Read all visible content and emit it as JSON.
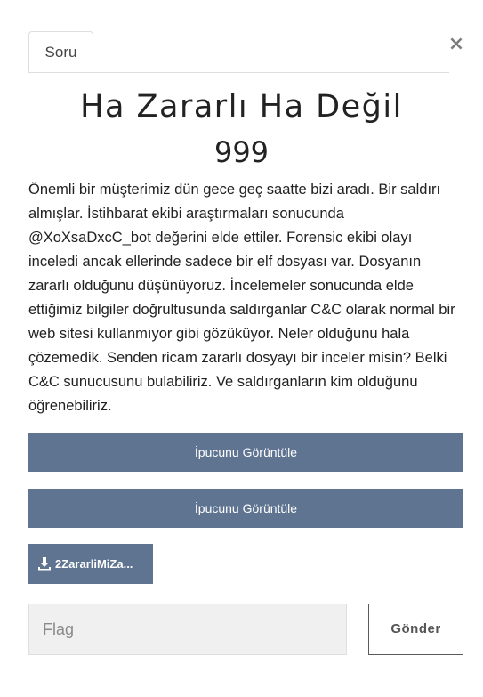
{
  "modal": {
    "close_icon": "close-icon",
    "close_label": "×",
    "tab": {
      "label": "Soru"
    }
  },
  "challenge": {
    "title": "Ha Zararlı Ha Değil",
    "points": "999",
    "description": "Önemli bir müşterimiz dün gece geç saatte bizi aradı. Bir saldırı almışlar. İstihbarat ekibi araştırmaları sonucunda @XoXsaDxcC_bot değerini elde ettiler. Forensic ekibi olayı inceledi ancak ellerinde sadece bir elf dosyası var. Dosyanın zararlı olduğunu düşünüyoruz. İncelemeler sonucunda elde ettiğimiz bilgiler doğrultusunda saldırganlar C&C olarak normal bir web sitesi kullanmıyor gibi gözüküyor. Neler olduğunu hala çözemedik. Senden ricam zararlı dosyayı bir inceler misin? Belki C&C sunucusunu bulabiliriz. Ve saldırganların kim olduğunu öğrenebiliriz."
  },
  "hints": [
    {
      "label": "İpucunu Görüntüle"
    },
    {
      "label": "İpucunu Görüntüle"
    }
  ],
  "file": {
    "icon": "download-icon",
    "label": "2ZararliMiZa..."
  },
  "submission": {
    "flag_placeholder": "Flag",
    "flag_value": "",
    "submit_label": "Gönder"
  },
  "colors": {
    "button_bg": "#5e7491",
    "input_bg": "#f0f0f0"
  }
}
